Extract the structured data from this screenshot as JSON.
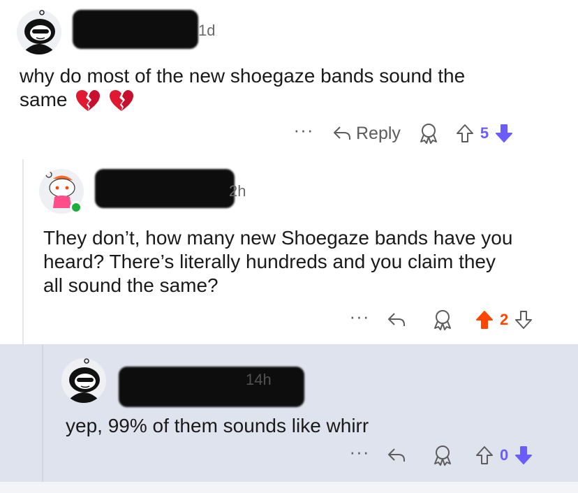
{
  "comments": [
    {
      "timestamp": "1d",
      "text": "why do most of the new shoegaze bands sound the same",
      "text_line1": "why do most of the new shoegaze bands sound the",
      "text_line2": "same",
      "emojis": [
        "broken-heart",
        "broken-heart"
      ],
      "actions": {
        "more": "···",
        "reply": "Reply",
        "score": "5",
        "vote_state": "downvoted"
      }
    },
    {
      "timestamp": "2h",
      "text_line1": "They don’t, how many new Shoegaze bands have you",
      "text_line2": "heard? There’s literally hundreds and you claim they",
      "text_line3": "all sound the same?",
      "actions": {
        "more": "···",
        "score": "2",
        "vote_state": "upvoted"
      }
    },
    {
      "timestamp": "14h",
      "text": "yep, 99% of them sounds like whirr",
      "actions": {
        "more": "···",
        "score": "0",
        "vote_state": "downvoted"
      }
    }
  ],
  "colors": {
    "upvote": "#ff4500",
    "downvote": "#6a5cff",
    "highlight_bg": "#dfe3ee"
  }
}
